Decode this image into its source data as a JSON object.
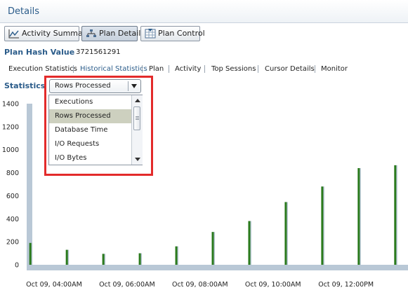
{
  "header": {
    "title": "Details"
  },
  "toolbar": [
    {
      "label": "Activity Summary",
      "icon": "line-chart-icon",
      "active": false
    },
    {
      "label": "Plan Details",
      "icon": "tree-diagram-icon",
      "active": true
    },
    {
      "label": "Plan Control",
      "icon": "plan-control-icon",
      "active": false
    }
  ],
  "plan_hash": {
    "label": "Plan Hash Value",
    "value": "3721561291"
  },
  "subtabs": [
    {
      "label": "Execution Statistics",
      "current": false
    },
    {
      "label": "Historical Statistics",
      "current": true
    },
    {
      "label": "Plan",
      "current": false
    },
    {
      "label": "Activity",
      "current": false
    },
    {
      "label": "Top Sessions",
      "current": false
    },
    {
      "label": "Cursor Details",
      "current": false
    },
    {
      "label": "Monitor",
      "current": false
    }
  ],
  "statistics": {
    "label": "Statistics",
    "selected": "Rows Processed",
    "options": [
      "Executions",
      "Rows Processed",
      "Database Time",
      "I/O Requests",
      "I/O Bytes"
    ]
  },
  "colors": {
    "accent": "#2b5c8a",
    "bar": "#2a7a1c",
    "bar_shadow": "#b9c8d6",
    "highlight": "#e32b2b"
  },
  "chart_data": {
    "type": "bar",
    "y_ticks": [
      0,
      200,
      400,
      600,
      800,
      1000,
      1200,
      1400
    ],
    "ylim": [
      0,
      1400
    ],
    "x_tick_labels": [
      "Oct 09, 04:00AM",
      "Oct 09, 06:00AM",
      "Oct 09, 08:00AM",
      "Oct 09, 10:00AM",
      "Oct 09, 12:00PM"
    ],
    "x_range_hours": [
      3.25,
      13.7
    ],
    "series": [
      {
        "points": [
          {
            "hour": 3.35,
            "value": 190
          },
          {
            "hour": 4.35,
            "value": 130
          },
          {
            "hour": 5.35,
            "value": 95
          },
          {
            "hour": 6.35,
            "value": 100
          },
          {
            "hour": 7.35,
            "value": 160
          },
          {
            "hour": 8.35,
            "value": 285
          },
          {
            "hour": 9.35,
            "value": 380
          },
          {
            "hour": 10.35,
            "value": 545
          },
          {
            "hour": 11.35,
            "value": 680
          },
          {
            "hour": 12.35,
            "value": 840
          },
          {
            "hour": 13.35,
            "value": 865
          }
        ]
      }
    ]
  }
}
